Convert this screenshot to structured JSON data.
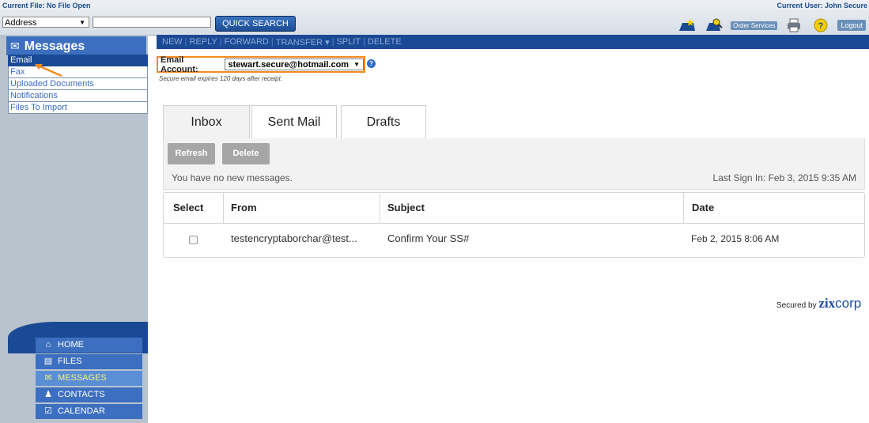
{
  "top": {
    "current_file": "Current File: No File Open",
    "current_user": "Current User: John Secure",
    "address_select": "Address",
    "quick_search": "QUICK SEARCH",
    "order_services": "Order Services",
    "logout": "Logout"
  },
  "sidebar": {
    "header": "Messages",
    "items": [
      {
        "label": "Email"
      },
      {
        "label": "Fax"
      },
      {
        "label": "Uploaded Documents"
      },
      {
        "label": "Notifications"
      },
      {
        "label": "Files To Import"
      }
    ],
    "nav": [
      {
        "label": "HOME",
        "icon": "home-icon"
      },
      {
        "label": "FILES",
        "icon": "files-icon"
      },
      {
        "label": "MESSAGES",
        "icon": "envelope-icon"
      },
      {
        "label": "CONTACTS",
        "icon": "contacts-icon"
      },
      {
        "label": "CALENDAR",
        "icon": "calendar-icon"
      }
    ]
  },
  "toolbar": [
    "NEW",
    "REPLY",
    "FORWARD",
    "TRANSFER ▾",
    "SPLIT",
    "DELETE"
  ],
  "account": {
    "label": "Email Account:",
    "value": "stewart.secure@hotmail.com",
    "note": "Secure email expires 120 days after receipt."
  },
  "tabs": [
    "Inbox",
    "Sent Mail",
    "Drafts"
  ],
  "panel": {
    "refresh": "Refresh",
    "delete": "Delete",
    "status": "You have no new messages.",
    "last_sign_in": "Last Sign In: Feb 3, 2015 9:35 AM"
  },
  "table": {
    "headers": [
      "Select",
      "From",
      "Subject",
      "Date"
    ],
    "rows": [
      {
        "from": "testencryptaborchar@test...",
        "subject": "Confirm Your SS#",
        "date": "Feb 2, 2015 8:06 AM"
      }
    ]
  },
  "footer": {
    "secured_by": "Secured by",
    "zix": "zix",
    "corp": "corp"
  },
  "colors": {
    "nav_blue": "#1b4a95",
    "accent_orange": "#f08a20",
    "active_nav_text": "#f3ef82"
  }
}
